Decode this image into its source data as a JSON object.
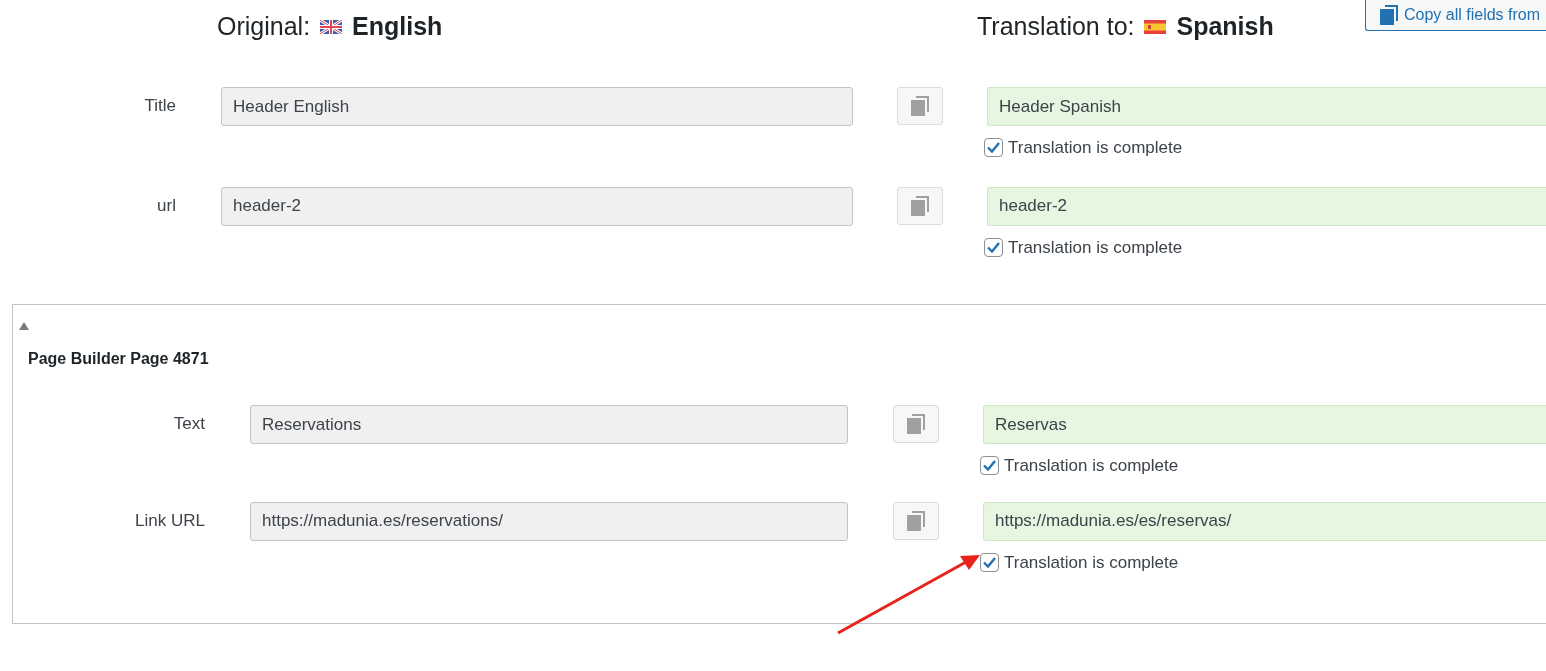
{
  "header": {
    "original": {
      "label": "Original:",
      "language": "English"
    },
    "translation": {
      "label": "Translation to:",
      "language": "Spanish"
    },
    "copy_all_button": "Copy all fields from"
  },
  "fields": [
    {
      "label": "Title",
      "original": "Header English",
      "translation": "Header Spanish",
      "complete": {
        "label": "Translation is complete",
        "checked": true
      }
    },
    {
      "label": "url",
      "original": "header-2",
      "translation": "header-2",
      "complete": {
        "label": "Translation is complete",
        "checked": true
      }
    }
  ],
  "section": {
    "title": "Page Builder Page 4871",
    "expanded": true,
    "fields": [
      {
        "label": "Text",
        "original": "Reservations",
        "translation": "Reservas",
        "complete": {
          "label": "Translation is complete",
          "checked": true
        }
      },
      {
        "label": "Link URL",
        "original": "https://madunia.es/reservations/",
        "translation": "https://madunia.es/es/reservas/",
        "complete": {
          "label": "Translation is complete",
          "checked": true
        }
      }
    ]
  }
}
